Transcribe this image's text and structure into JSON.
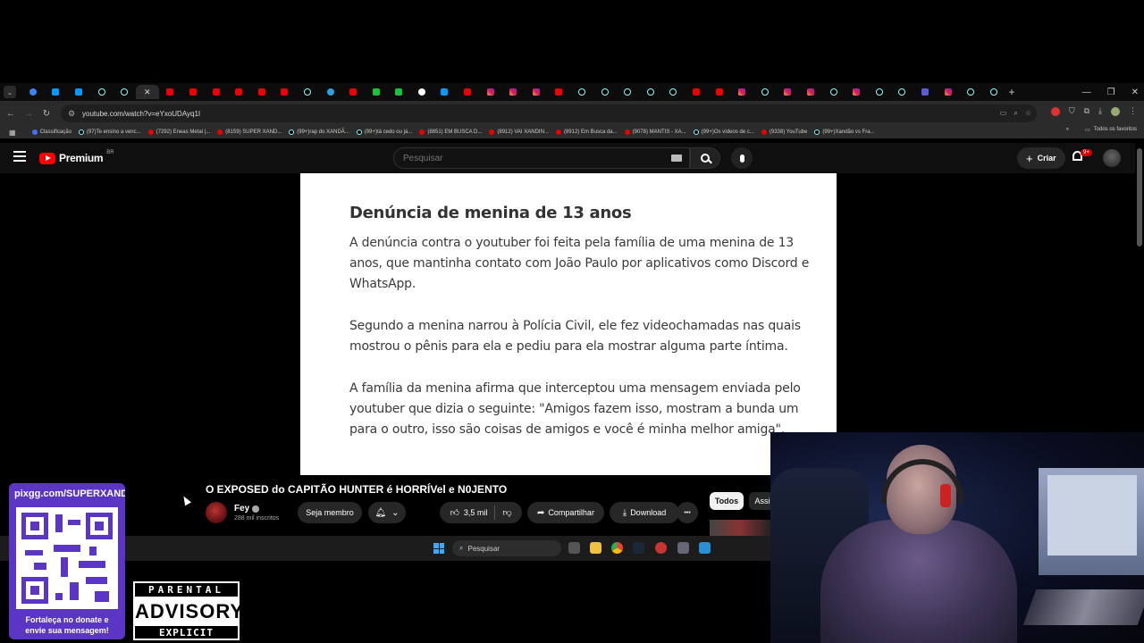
{
  "browser": {
    "tabs": [
      "dropdown",
      "bl",
      "cc",
      "cc",
      "tt",
      "tt",
      "active",
      "yt",
      "yt",
      "yt",
      "yt",
      "yt",
      "yt",
      "tt",
      "tg",
      "yt",
      "gr",
      "gr",
      "gg",
      "cc",
      "yt",
      "ig",
      "ig",
      "ig",
      "yt",
      "tt",
      "tt",
      "tt",
      "tt",
      "tt",
      "yt",
      "yt",
      "ig",
      "tt",
      "ig",
      "ig",
      "tt",
      "ig",
      "tt",
      "tt",
      "sv",
      "ig",
      "tt",
      "tt"
    ],
    "url": "youtube.com/watch?v=eYxoUDAyq1I",
    "bookmarks": [
      {
        "label": "Classificação",
        "color": "#4a6cf7"
      },
      {
        "label": "(97)Te ensino a venc...",
        "color": "#000"
      },
      {
        "label": "(7292) Eneas Metal |...",
        "color": "#e00"
      },
      {
        "label": "(8159) SUPER XAND...",
        "color": "#e00"
      },
      {
        "label": "(99+)rap do XANDÃ...",
        "color": "#000"
      },
      {
        "label": "(99+)tá cedo ou já...",
        "color": "#000"
      },
      {
        "label": "(8851) EM BUSCA D...",
        "color": "#e00"
      },
      {
        "label": "(8912) VAI XANDIN...",
        "color": "#e00"
      },
      {
        "label": "(8912) Em Busca da...",
        "color": "#e00"
      },
      {
        "label": "(9078) MANTIS - XA...",
        "color": "#e00"
      },
      {
        "label": "(99+)Os vídeos de c...",
        "color": "#000"
      },
      {
        "label": "(9338) YouTube",
        "color": "#e00"
      },
      {
        "label": "(99+)Xandão vs Fra...",
        "color": "#000"
      }
    ],
    "bookmarks_more": "»",
    "all_favorites": "Todos os favoritos"
  },
  "youtube": {
    "logo_text": "Premium",
    "region": "BR",
    "search_placeholder": "Pesquisar",
    "create_label": "Criar",
    "notifications": "9+"
  },
  "article": {
    "heading": "Denúncia de menina de 13 anos",
    "paragraphs": [
      "A denúncia contra o youtuber foi feita pela família de uma menina de 13 anos, que mantinha contato com João Paulo por aplicativos como Discord e WhatsApp.",
      "Segundo a menina narrou à Polícia Civil, ele fez videochamadas nas quais mostrou o pênis para ela e pediu para ela mostrar alguma parte íntima.",
      "A família da menina afirma que interceptou uma mensagem enviada pelo youtuber que dizia o seguinte: \"Amigos fazem isso, mostram a bunda um para o outro, isso são coisas de amigos e você é minha melhor amiga\"."
    ]
  },
  "video": {
    "title": "O EXPOSED do CAPITÃO HUNTER é HORRÍVel e N0JENTO",
    "channel": "Fey",
    "subscribers": "288 mil inscritos",
    "member_label": "Seja membro",
    "likes": "3,5 mil",
    "share_label": "Compartilhar",
    "download_label": "Download",
    "more_label": "•••",
    "chips": [
      "Todos",
      "Assi"
    ]
  },
  "taskbar": {
    "search_placeholder": "Pesquisar"
  },
  "overlay": {
    "qr_url": "pixgg.com/SUPERXANDÃ",
    "qr_caption_1": "Fortaleça no donate e",
    "qr_caption_2": "envie sua mensagem!",
    "advisory_top": "PARENTAL",
    "advisory_mid": "ADVISORY",
    "advisory_bot": "EXPLICIT CONTENT"
  }
}
